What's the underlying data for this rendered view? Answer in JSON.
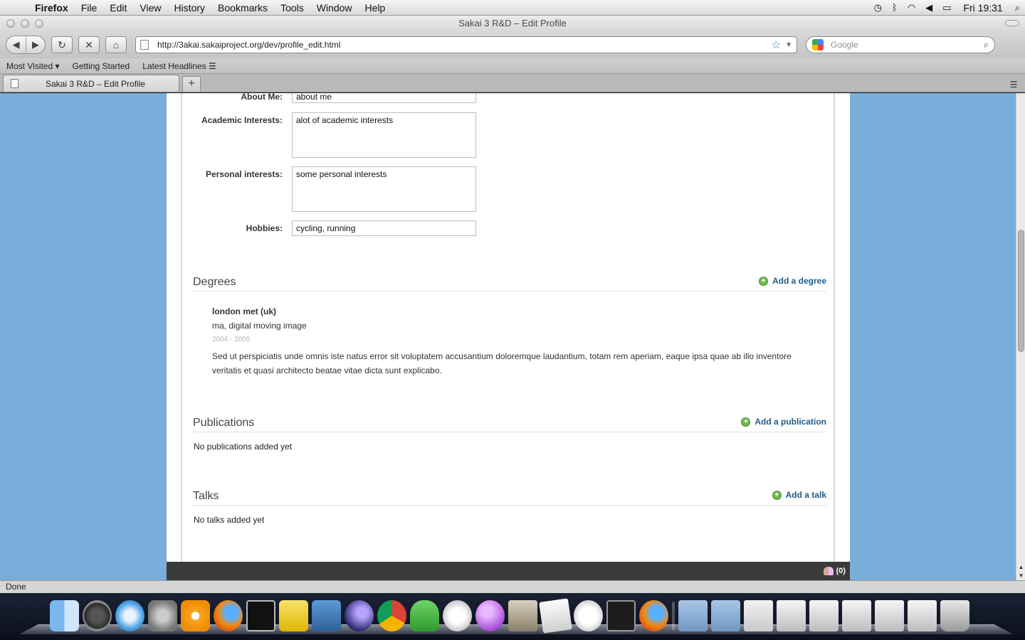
{
  "menubar": {
    "app": "Firefox",
    "items": [
      "File",
      "Edit",
      "View",
      "History",
      "Bookmarks",
      "Tools",
      "Window",
      "Help"
    ],
    "clock": "Fri 19:31"
  },
  "window": {
    "title": "Sakai 3 R&D – Edit Profile"
  },
  "navbar": {
    "url": "http://3akai.sakaiproject.org/dev/profile_edit.html",
    "search_placeholder": "Google"
  },
  "bookmarks": {
    "most_visited": "Most Visited",
    "getting_started": "Getting Started",
    "latest_headlines": "Latest Headlines"
  },
  "tabs": [
    {
      "label": "Sakai 3 R&D – Edit Profile"
    }
  ],
  "profile": {
    "fields": [
      {
        "label": "About Me:",
        "value": "about me"
      },
      {
        "label": "Academic Interests:",
        "value": "alot of academic interests"
      },
      {
        "label": "Personal interests:",
        "value": "some personal interests"
      },
      {
        "label": "Hobbies:",
        "value": "cycling, running"
      }
    ]
  },
  "degrees": {
    "title": "Degrees",
    "add_label": "Add a degree",
    "items": [
      {
        "school": "london met (uk)",
        "degree": "ma, digital moving image",
        "years": "2004 - 2005",
        "description": "Sed ut perspiciatis unde omnis iste natus error sit voluptatem accusantium doloremque laudantium, totam rem aperiam, eaque ipsa quae ab illo inventore veritatis et quasi architecto beatae vitae dicta sunt explicabo."
      }
    ]
  },
  "publications": {
    "title": "Publications",
    "add_label": "Add a publication",
    "empty": "No publications added yet"
  },
  "talks": {
    "title": "Talks",
    "add_label": "Add a talk",
    "empty": "No talks added yet"
  },
  "chat": {
    "count": "(0)"
  },
  "status": "Done",
  "colors": {
    "page_background": "#7aadd9",
    "link": "#1e5d8a",
    "add_icon": "#6fb84b",
    "footer": "#3a3a3a"
  }
}
